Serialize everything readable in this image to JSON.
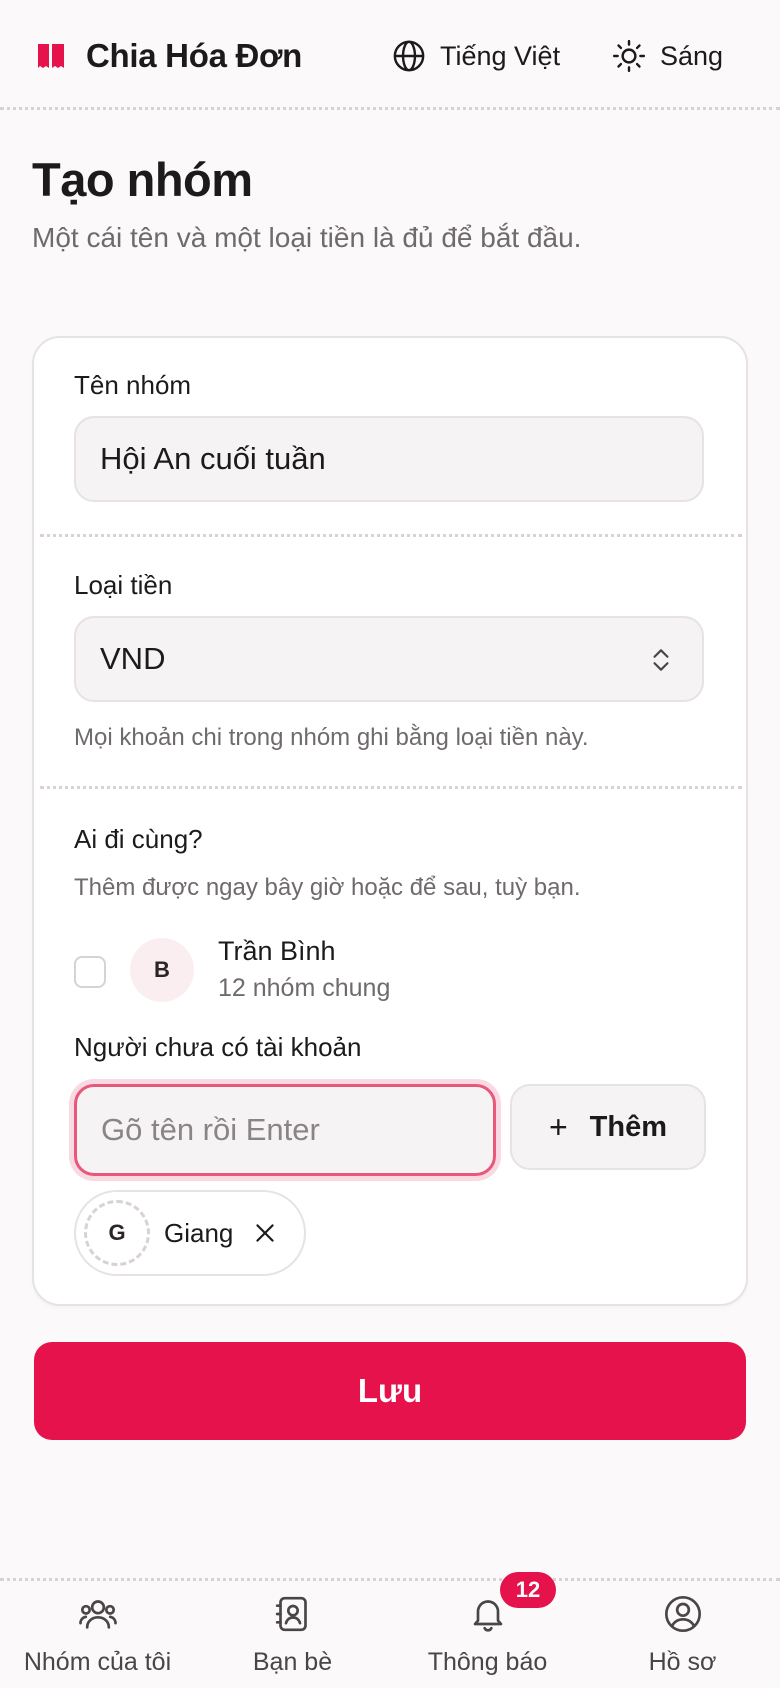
{
  "header": {
    "app_name": "Chia Hóa Đơn",
    "language_label": "Tiếng Việt",
    "theme_label": "Sáng",
    "brand_color": "#e5124b"
  },
  "page": {
    "title": "Tạo nhóm",
    "subtitle": "Một cái tên và một loại tiền là đủ để bắt đầu."
  },
  "form": {
    "group_name_label": "Tên nhóm",
    "group_name_value": "Hội An cuối tuần",
    "currency_label": "Loại tiền",
    "currency_value": "VND",
    "currency_hint": "Mọi khoản chi trong nhóm ghi bằng loại tiền này.",
    "members_label": "Ai đi cùng?",
    "members_hint": "Thêm được ngay bây giờ hoặc để sau, tuỳ bạn.",
    "friends": [
      {
        "initial": "B",
        "name": "Trần Bình",
        "meta": "12 nhóm chung",
        "checked": false
      }
    ],
    "guest_label": "Người chưa có tài khoản",
    "guest_placeholder": "Gõ tên rồi Enter",
    "add_button_label": "Thêm",
    "guests": [
      {
        "initial": "G",
        "name": "Giang"
      }
    ]
  },
  "save_label": "Lưu",
  "nav": {
    "items": [
      {
        "label": "Nhóm của tôi",
        "icon": "users-icon"
      },
      {
        "label": "Bạn bè",
        "icon": "contacts-icon"
      },
      {
        "label": "Thông báo",
        "icon": "bell-icon",
        "badge": "12"
      },
      {
        "label": "Hồ sơ",
        "icon": "profile-icon"
      }
    ]
  }
}
